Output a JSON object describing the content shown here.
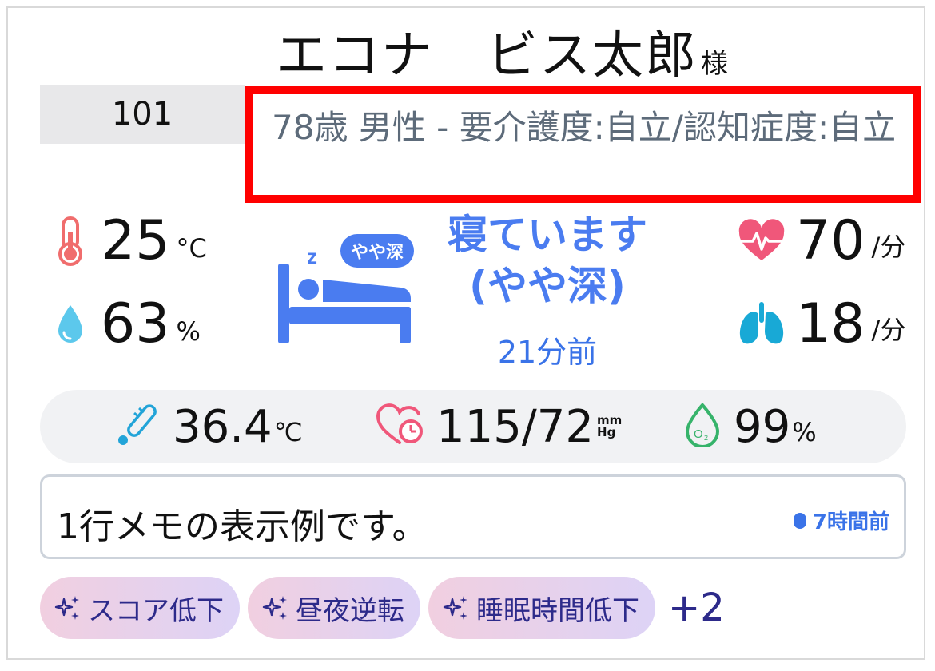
{
  "resident": {
    "name": "エコナ　ビス太郎",
    "honorific": "様",
    "room": "101",
    "profile": "78歳 男性 - 要介護度:自立/認知症度:自立"
  },
  "environment": {
    "temperature": {
      "value": "25",
      "unit": "°C",
      "icon": "thermometer-icon"
    },
    "humidity": {
      "value": "63",
      "unit": "%",
      "icon": "water-drop-icon"
    }
  },
  "sleep": {
    "depth_badge": "やや深",
    "status": "寝ています(やや深)",
    "elapsed": "21分前",
    "icon": "sleeping-in-bed-icon"
  },
  "realtime": {
    "heart_rate": {
      "value": "70",
      "unit": "/分",
      "icon": "heartbeat-icon"
    },
    "respiration": {
      "value": "18",
      "unit": "/分",
      "icon": "lungs-icon"
    }
  },
  "vitals": {
    "body_temp": {
      "value": "36.4",
      "unit": "℃",
      "icon": "clinical-thermometer-icon"
    },
    "blood_pressure": {
      "value": "115/72",
      "unit_top": "mm",
      "unit_bottom": "Hg",
      "icon": "heart-gauge-icon"
    },
    "spo2": {
      "value": "99",
      "unit": "%",
      "icon": "oxygen-drop-icon"
    }
  },
  "memo": {
    "text": "1行メモの表示例です。",
    "time": "7時間前"
  },
  "tags": {
    "items": [
      "スコア低下",
      "昼夜逆転",
      "睡眠時間低下"
    ],
    "more": "+2"
  },
  "colors": {
    "accent_blue": "#4a7cf0",
    "highlight_border": "#ff0000",
    "tag_text": "#2d2a8a",
    "heart_pink": "#f0577a",
    "lung_cyan": "#18a9d6"
  }
}
